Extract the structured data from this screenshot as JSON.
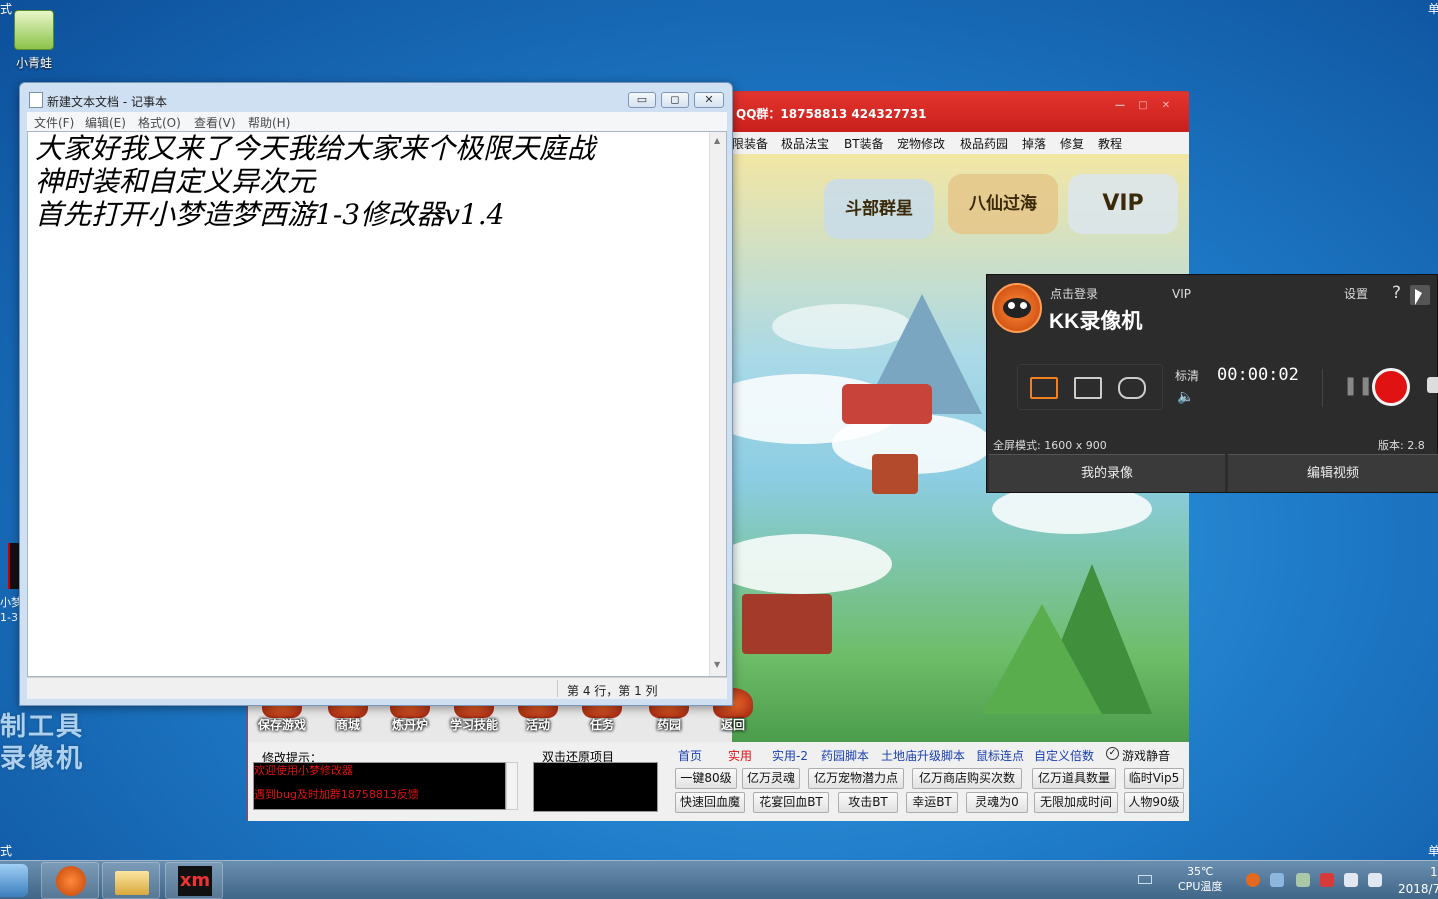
{
  "desktop": {
    "icons": [
      {
        "label": "小青蛙"
      },
      {
        "label": "小梦"
      },
      {
        "label": "1-3"
      }
    ],
    "watermark_lines": [
      "制工具",
      "录像机"
    ],
    "corner_chars": {
      "top_left": "式",
      "top_right": "单",
      "bottom_left": "式",
      "bottom_right": "单"
    }
  },
  "notepad": {
    "title": "新建文本文档 - 记事本",
    "menu": [
      "文件(F)",
      "编辑(E)",
      "格式(O)",
      "查看(V)",
      "帮助(H)"
    ],
    "content": "大家好我又来了今天我给大家来个极限天庭战\n神时装和自定义异次元\n首先打开小梦造梦西游1-3修改器v1.4",
    "status": "第 4 行，第 1 列",
    "controls": {
      "minimize": "▭",
      "maximize": "◻",
      "close": "✕"
    }
  },
  "game": {
    "title": "QQ群：18758813   424327731",
    "menu": [
      "限装备",
      "极品法宝",
      "BT装备",
      "宠物修改",
      "极品药园",
      "掉落",
      "修复",
      "教程"
    ],
    "art_icons": [
      "斗部群星",
      "八仙过海",
      "VIP"
    ],
    "bottom_buttons": [
      "保存游戏",
      "商城",
      "炼丹炉",
      "学习技能",
      "活动",
      "任务",
      "药园",
      "返回"
    ],
    "panel": {
      "tip_label": "修改提示：",
      "tip_lines": [
        "欢迎使用小梦修改器",
        "遇到bug及时加群18758813反馈"
      ],
      "restore_label": "双击还原项目",
      "tabs": [
        "首页",
        "实用",
        "实用-2",
        "药园脚本",
        "土地庙升级脚本",
        "鼠标连点",
        "自定义倍数"
      ],
      "mute_label": "游戏静音",
      "row1": [
        "一键80级",
        "亿万灵魂",
        "亿万宠物潜力点",
        "亿万商店购买次数",
        "亿万道具数量",
        "临时Vip5"
      ],
      "row2": [
        "快速回血魔",
        "花宴回血BT",
        "攻击BT",
        "幸运BT",
        "灵魂为0",
        "无限加成时间",
        "人物90级"
      ]
    }
  },
  "kk_recorder": {
    "login": "点击登录",
    "vip": "VIP",
    "settings": "设置",
    "help": "?",
    "brand": "KK录像机",
    "quality": "标清",
    "timer": "00:00:02",
    "mode": "全屏模式: 1600 x 900",
    "version": "版本: 2.8",
    "my_videos": "我的录像",
    "edit_video": "编辑视频"
  },
  "taskbar": {
    "temp_value": "35℃",
    "temp_label": "CPU温度",
    "clock_time": "1",
    "clock_date": "2018/7"
  },
  "colors": {
    "game_red": "#d62a25",
    "kk_bg": "#2c2c2c",
    "rec_red": "#e11212",
    "tip_red": "#e01010"
  }
}
